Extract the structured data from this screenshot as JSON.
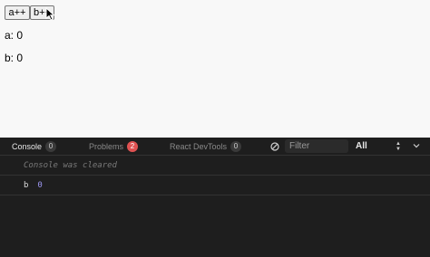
{
  "preview": {
    "button_a": "a++",
    "button_b": "b++",
    "state_a": "a: 0",
    "state_b": "b: 0"
  },
  "devtools": {
    "tabs": [
      {
        "label": "Console",
        "count": "0"
      },
      {
        "label": "Problems",
        "count": "2"
      },
      {
        "label": "React DevTools",
        "count": "0"
      }
    ],
    "filter_placeholder": "Filter",
    "level": "All",
    "icons": {
      "clear": "clear-console-icon",
      "collapse": "chevron-down-icon"
    },
    "colors": {
      "error_badge": "#e05252",
      "number_value": "#9d97f2"
    }
  },
  "console": {
    "cleared_message": "Console was cleared",
    "logs": [
      {
        "label": "b",
        "value": "0"
      }
    ]
  }
}
